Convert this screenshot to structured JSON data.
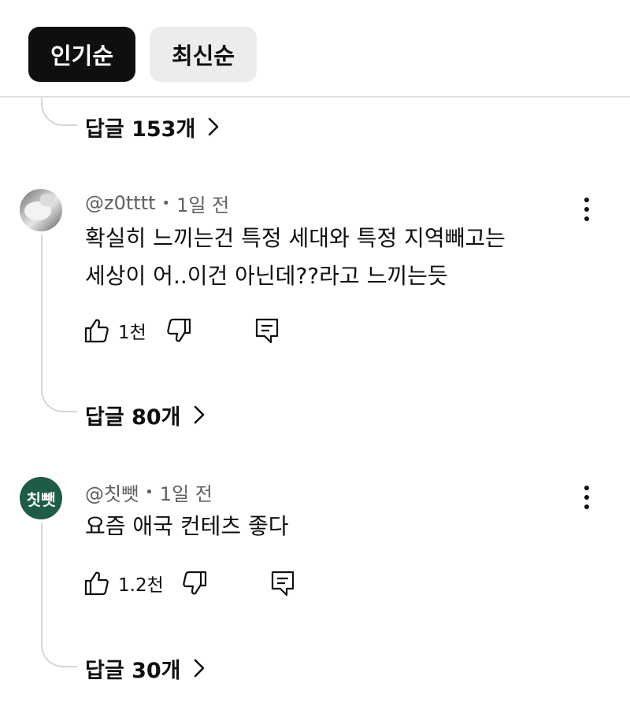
{
  "sort": {
    "popular_label": "인기순",
    "newest_label": "최신순"
  },
  "thread0": {
    "replies_label": "답글 153개"
  },
  "comments": [
    {
      "author": "@z0tttt",
      "time": "1일 전",
      "avatar_type": "photo",
      "lines": [
        "확실히 느끼는건 특정 세대와 특정 지역빼고는",
        "세상이 어..이건 아닌데??라고 느끼는듯"
      ],
      "likes": "1천",
      "replies_label": "답글 80개"
    },
    {
      "author": "@칫뺏",
      "time": "1일 전",
      "avatar_text": "칫뺏",
      "avatar_color": "#1d5d45",
      "lines": [
        "요즘 애국 컨테츠 좋다"
      ],
      "likes": "1.2천",
      "replies_label": "답글 30개"
    }
  ],
  "icons": {
    "like": "thumbs-up-icon",
    "dislike": "thumbs-down-icon",
    "reply": "comment-reply-icon",
    "more": "kebab-menu-icon",
    "chevron": "chevron-right-icon"
  }
}
